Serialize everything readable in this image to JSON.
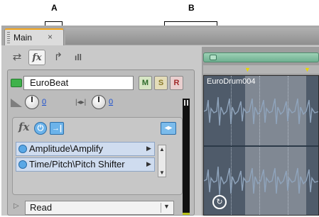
{
  "callouts": {
    "a": "A",
    "b": "B"
  },
  "tab": {
    "label": "Main",
    "close": "×"
  },
  "toolbar": {
    "icons": [
      "io-arrows-icon",
      "fx-icon",
      "send-icon",
      "eq-icon"
    ],
    "fx_label": "fx"
  },
  "track": {
    "name": "EuroBeat",
    "buttons": {
      "mute": "M",
      "solo": "S",
      "record": "R"
    },
    "volume_value": "0",
    "pan_value": "0"
  },
  "effects": {
    "label": "fx",
    "slots": [
      {
        "label": "Amplitude\\Amplify"
      },
      {
        "label": "Time/Pitch\\Pitch Shifter"
      }
    ]
  },
  "automation": {
    "mode": "Read"
  },
  "clip": {
    "name": "EuroDrum004"
  },
  "colors": {
    "accent_tab": "#f2a41b",
    "power_blue": "#6cb3ea",
    "track_green": "#3fb24b",
    "overview_green": "#6fb091",
    "lane": "#4f5b6a"
  }
}
